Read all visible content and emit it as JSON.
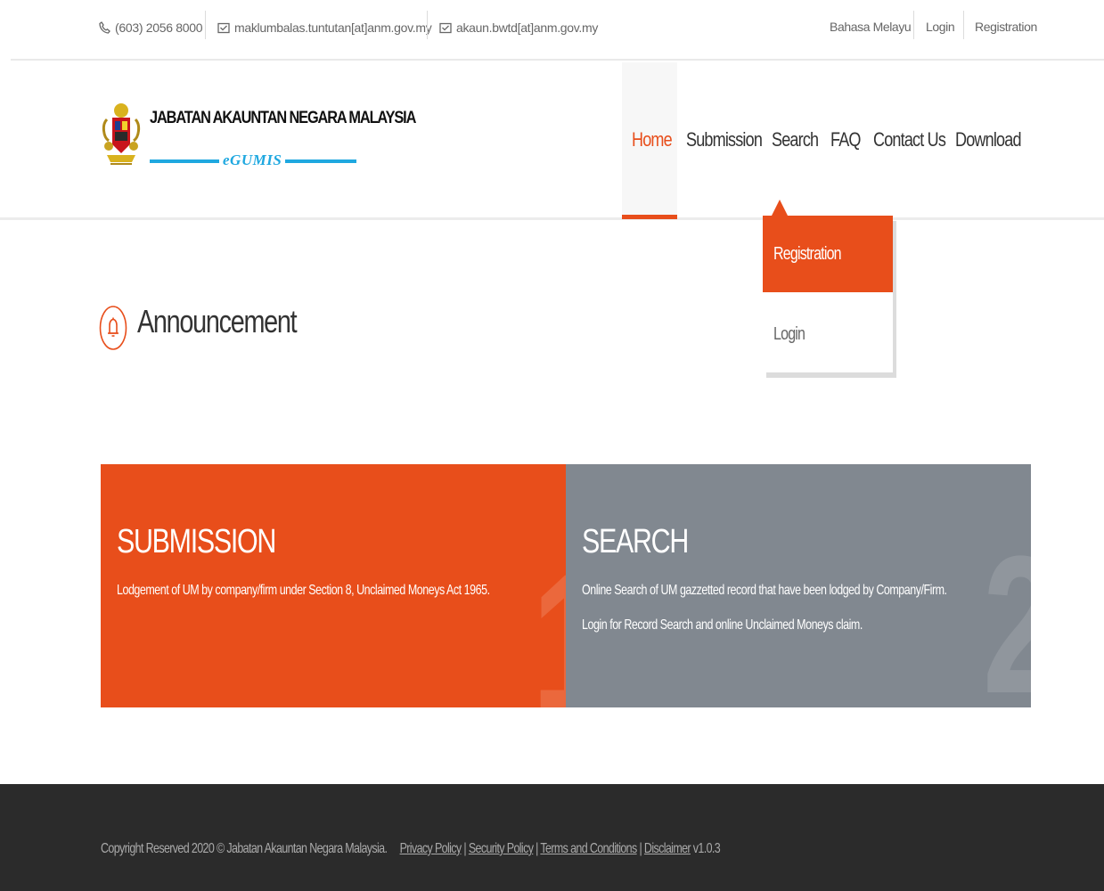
{
  "topbar": {
    "phone": "(603) 2056 8000",
    "email1": "maklumbalas.tuntutan[at]anm.gov.my",
    "email2": "akaun.bwtd[at]anm.gov.my",
    "language": "Bahasa Melayu",
    "login": "Login",
    "registration": "Registration"
  },
  "header": {
    "logo_title": "JABATAN AKAUNTAN NEGARA MALAYSIA",
    "logo_subtitle": "eGUMIS",
    "nav": [
      "Home",
      "Submission",
      "Search",
      "FAQ",
      "Contact Us",
      "Download"
    ],
    "active_nav": "Home"
  },
  "dropdown": {
    "items": [
      "Registration",
      "Login"
    ],
    "active": "Registration"
  },
  "announcement": {
    "title": "Announcement"
  },
  "panels": {
    "submission": {
      "title": "SUBMISSION",
      "text": "Lodgement of UM by company/firm under Section 8, Unclaimed Moneys Act 1965.",
      "number": "1"
    },
    "search": {
      "title": "SEARCH",
      "text1": "Online Search of UM gazzetted record that have been lodged by Company/Firm.",
      "text2": "Login for Record Search and online Unclaimed Moneys claim.",
      "number": "2"
    }
  },
  "footer": {
    "copyright": "Copyright Reserved 2020 © Jabatan Akauntan Negara Malaysia.",
    "privacy": "Privacy Policy",
    "security": "Security Policy",
    "terms": "Terms and Conditions",
    "disclaimer": "Disclaimer",
    "version": "v1.0.3"
  },
  "colors": {
    "accent": "#e84e1b",
    "panel_gray": "#818890",
    "logo_blue": "#1fa8e0",
    "footer_bg": "#2b2b2b"
  },
  "icons": [
    "phone-icon",
    "envelope-icon",
    "bell-icon",
    "crest-logo"
  ]
}
